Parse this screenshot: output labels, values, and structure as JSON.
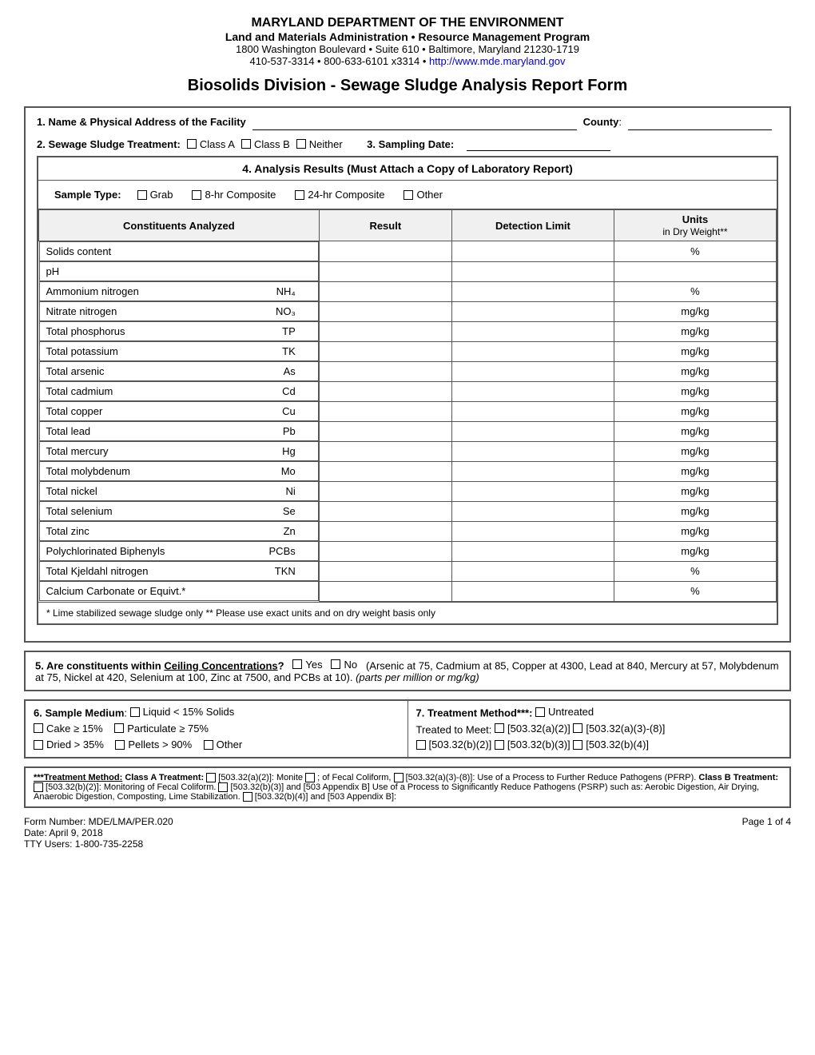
{
  "header": {
    "line1": "MARYLAND DEPARTMENT OF THE ENVIRONMENT",
    "line2": "Land and Materials Administration • Resource Management Program",
    "line3": "1800 Washington Boulevard • Suite 610 • Baltimore, Maryland 21230-1719",
    "line4": "410-537-3314 • 800-633-6101 x3314 • ",
    "website": "http://www.mde.maryland.gov"
  },
  "main_title": "Biosolids Division - Sewage Sludge Analysis Report Form",
  "section1": {
    "label": "1.  Name & Physical Address of the Facility",
    "county_label": "County"
  },
  "section2": {
    "label": "2.  Sewage Sludge Treatment:",
    "options": [
      "Class A",
      "Class B",
      "Neither"
    ],
    "section3_label": "3.  Sampling Date:"
  },
  "section4": {
    "title": "4.  Analysis Results (Must Attach a Copy of Laboratory Report)",
    "sample_type_label": "Sample Type:",
    "sample_options": [
      "Grab",
      "8-hr Composite",
      "24-hr Composite",
      "Other"
    ],
    "table": {
      "headers": [
        "Constituents Analyzed",
        "Result",
        "Detection Limit",
        "Units\nin Dry Weight**"
      ],
      "rows": [
        {
          "name": "Solids content",
          "symbol": "",
          "unit": "%"
        },
        {
          "name": "pH",
          "symbol": "",
          "unit": ""
        },
        {
          "name": "Ammonium nitrogen",
          "symbol": "NH₄",
          "unit": "%"
        },
        {
          "name": "Nitrate nitrogen",
          "symbol": "NO₃",
          "unit": "mg/kg"
        },
        {
          "name": "Total phosphorus",
          "symbol": "TP",
          "unit": "mg/kg"
        },
        {
          "name": "Total potassium",
          "symbol": "TK",
          "unit": "mg/kg"
        },
        {
          "name": "Total arsenic",
          "symbol": "As",
          "unit": "mg/kg"
        },
        {
          "name": "Total cadmium",
          "symbol": "Cd",
          "unit": "mg/kg"
        },
        {
          "name": "Total copper",
          "symbol": "Cu",
          "unit": "mg/kg"
        },
        {
          "name": "Total lead",
          "symbol": "Pb",
          "unit": "mg/kg"
        },
        {
          "name": "Total mercury",
          "symbol": "Hg",
          "unit": "mg/kg"
        },
        {
          "name": "Total molybdenum",
          "symbol": "Mo",
          "unit": "mg/kg"
        },
        {
          "name": "Total nickel",
          "symbol": "Ni",
          "unit": "mg/kg"
        },
        {
          "name": "Total selenium",
          "symbol": "Se",
          "unit": "mg/kg"
        },
        {
          "name": "Total zinc",
          "symbol": "Zn",
          "unit": "mg/kg"
        },
        {
          "name": "Polychlorinated Biphenyls",
          "symbol": "PCBs",
          "unit": "mg/kg"
        },
        {
          "name": "Total Kjeldahl nitrogen",
          "symbol": "TKN",
          "unit": "%"
        },
        {
          "name": "Calcium Carbonate or Equivt.*",
          "symbol": "",
          "unit": "%"
        }
      ]
    },
    "table_note": "* Lime stabilized sewage sludge only     ** Please use exact units and on dry weight basis only"
  },
  "section5": {
    "label": "5.",
    "text": "Are constituents within Ceiling Concentrations?",
    "options": [
      "Yes",
      "No"
    ],
    "note": "(Arsenic at 75, Cadmium at 85, Copper at 4300, Lead at 840, Mercury at 57, Molybdenum at 75, Nickel at 420, Selenium at 100, Zinc at 7500, and PCBs at 10).",
    "note_italic": "(parts per million or mg/kg)"
  },
  "section6": {
    "label": "6. Sample Medium:",
    "options": [
      "Liquid < 15% Solids",
      "Cake ≥ 15%",
      "Particulate ≥ 75%",
      "Dried > 35%",
      "Pellets > 90%",
      "Other"
    ]
  },
  "section7": {
    "label": "7. Treatment Method***:",
    "options": [
      "Untreated",
      "Treated to Meet: [503.32(a)(2)]",
      "[503.32(a)(3)-(8)]",
      "[503.32(b)(2)]",
      "[503.32(b)(3)]",
      "[503.32(b)(4)]"
    ]
  },
  "footnote": {
    "text": "***Treatment Method: Class A Treatment: [503.32(a)(2)]: Monitoring of Fecal Coliform,  [503.32(a)(3)-(8)]: Use of a Process to Further Reduce Pathogens (PFRP).  Class B Treatment: [503.32(b)(2)]: Monitoring of Fecal Coliform.  [503.32(b)(3)] and [503 Appendix B] Use of a Process to Significantly Reduce Pathogens (PSRP) such as: Aerobic Digestion, Air Drying, Anaerobic Digestion, Composting, Lime Stabilization.  [503.32(b)(4)] and [503 Appendix B]:"
  },
  "footer": {
    "form_number": "Form Number:  MDE/LMA/PER.020",
    "date": "Date:  April 9, 2018",
    "tty": "TTY Users:  1-800-735-2258",
    "page": "Page 1 of 4"
  }
}
